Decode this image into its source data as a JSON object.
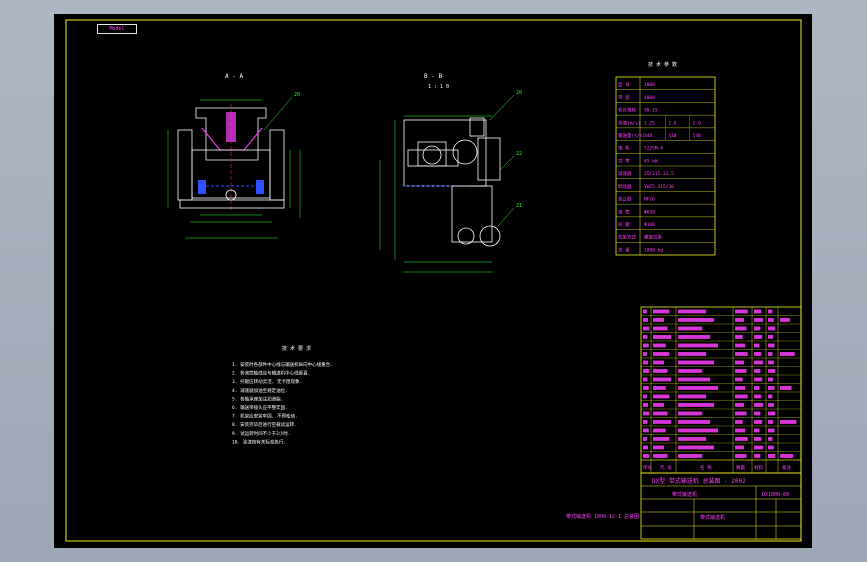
{
  "tab": {
    "label": "Model"
  },
  "views": {
    "front_view_label": "A - A",
    "side_view_label": "B - B",
    "side_view_scale": "1 : 1 0"
  },
  "callouts": [
    "20",
    "21",
    "22"
  ],
  "spec_table": {
    "title": "技 术 参 数",
    "rows": [
      [
        "型  号",
        "1000"
      ],
      [
        "带  宽",
        "4000"
      ],
      [
        "机长规格",
        "90-15"
      ],
      [
        "带速(m/s)",
        "1.25",
        "1.6",
        "2.0"
      ],
      [
        "输送量(t/h)",
        "340",
        "430",
        "540"
      ],
      [
        "电  机",
        "Y225M-4"
      ],
      [
        "功  率",
        "45 kW"
      ],
      [
        "减速器",
        "ZSY315-31.5"
      ],
      [
        "制动器",
        "YWZ5-315/30"
      ],
      [
        "逆止器",
        "NF20"
      ],
      [
        "滚  筒",
        "Φ630"
      ],
      [
        "托  辊",
        "Φ108"
      ],
      [
        "拉紧方式",
        "螺旋拉紧"
      ],
      [
        "总  重",
        "1800 kg"
      ]
    ]
  },
  "notes": {
    "title": "技 术 要 求",
    "items": [
      "1. 安装时各部件中心线与输送机纵向中心线重合.",
      "2. 各滚筒轴线应与输送机中心线垂直.",
      "3. 托辊应转动灵活, 无卡阻现象.",
      "4. 减速器加油至规定油位.",
      "5. 各轴承座加注润滑脂.",
      "6. 输送带接头应平整牢固.",
      "7. 机架应安装牢固, 不得松动.",
      "8. 安装完毕后进行空载试运转.",
      "9. 试运转时间不少于2小时.",
      "10. 涂漆按有关标准执行."
    ]
  },
  "bom": {
    "header": [
      "序号",
      "代 号",
      "名 称",
      "数量",
      "材料",
      "备注"
    ],
    "row_count": 18
  },
  "title_block": {
    "company": "DX型 带式输送机 总装图 - 2002",
    "drawing_no": "DX1000-00",
    "project_name": "带式输送机"
  },
  "left_caption": "带式输送机 1000-12-1 总装图",
  "colors": {
    "background": "#000000",
    "frame": "#f0f020",
    "geometry": "#ffffff",
    "dimensions": "#20ff20",
    "callouts": "#20ff20",
    "table_text": "#ff40ff",
    "hidden_lines": "#3050ff"
  }
}
